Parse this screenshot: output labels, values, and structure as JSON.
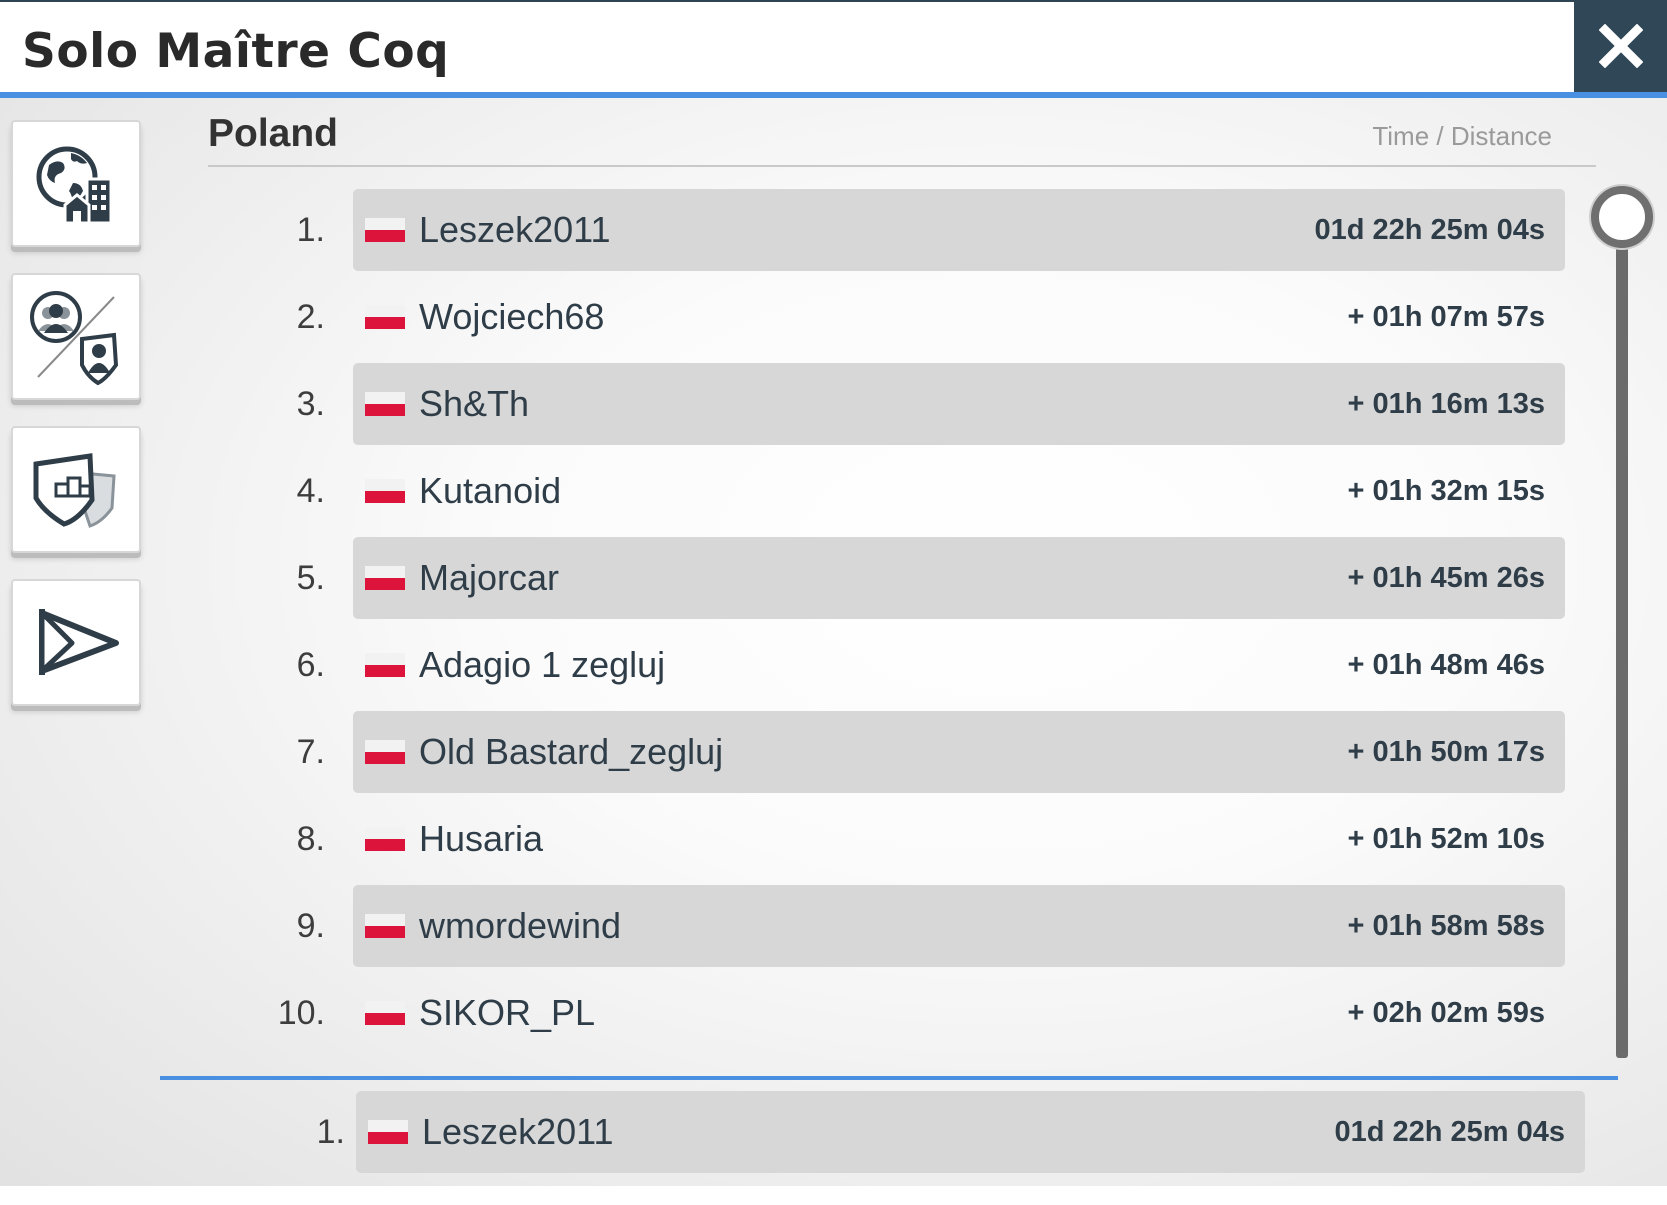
{
  "header": {
    "title": "Solo Maître Coq",
    "close_icon": "close-icon"
  },
  "sidebar": {
    "items": [
      {
        "name": "world-city-icon"
      },
      {
        "name": "players-vs-teams-icon"
      },
      {
        "name": "team-podium-icon"
      },
      {
        "name": "regatta-flag-icon"
      }
    ]
  },
  "content": {
    "country": "Poland",
    "column_label": "Time / Distance"
  },
  "ranking": [
    {
      "rank": "1.",
      "name": "Leszek2011",
      "time": "01d 22h 25m 04s",
      "flag": "pl"
    },
    {
      "rank": "2.",
      "name": "Wojciech68",
      "time": "+ 01h 07m 57s",
      "flag": "pl"
    },
    {
      "rank": "3.",
      "name": "Sh&Th",
      "time": "+ 01h 16m 13s",
      "flag": "pl"
    },
    {
      "rank": "4.",
      "name": "Kutanoid",
      "time": "+ 01h 32m 15s",
      "flag": "pl"
    },
    {
      "rank": "5.",
      "name": "Majorcar",
      "time": "+ 01h 45m 26s",
      "flag": "pl"
    },
    {
      "rank": "6.",
      "name": "Adagio 1 zegluj",
      "time": "+ 01h 48m 46s",
      "flag": "pl"
    },
    {
      "rank": "7.",
      "name": "Old Bastard_zegluj",
      "time": "+ 01h 50m 17s",
      "flag": "pl"
    },
    {
      "rank": "8.",
      "name": "Husaria",
      "time": "+ 01h 52m 10s",
      "flag": "pl"
    },
    {
      "rank": "9.",
      "name": "wmordewind",
      "time": "+ 01h 58m 58s",
      "flag": "pl"
    },
    {
      "rank": "10.",
      "name": "SIKOR_PL",
      "time": "+ 02h 02m 59s",
      "flag": "pl"
    }
  ],
  "footer": {
    "rank": "1.",
    "name": "Leszek2011",
    "time": "01d 22h 25m 04s",
    "flag": "pl"
  },
  "colors": {
    "accent": "#4a90e2",
    "close_bg": "#2f4756",
    "flag_red": "#dc143c",
    "row_shade": "#d7d7d7"
  }
}
